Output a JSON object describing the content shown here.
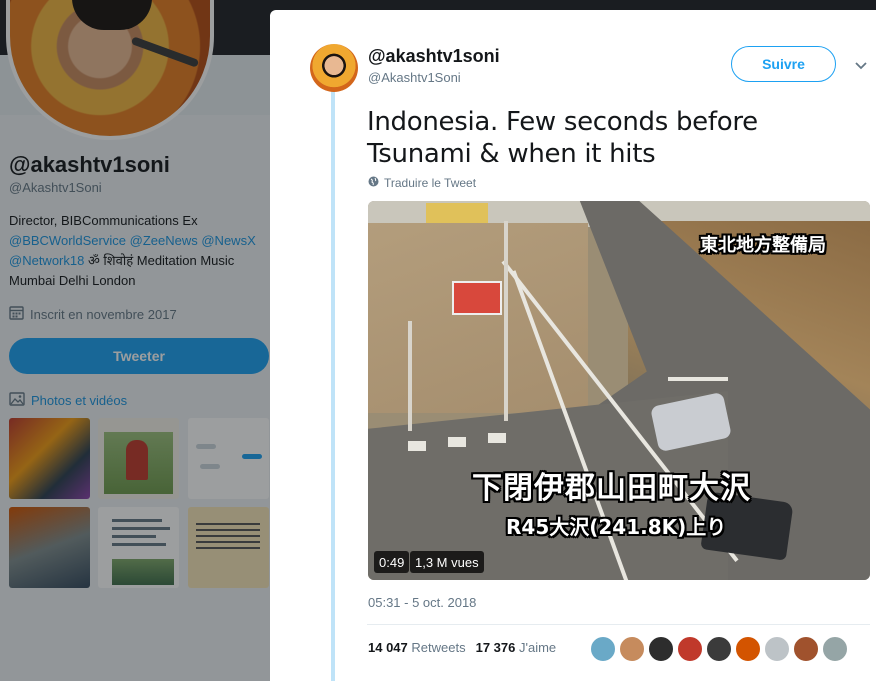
{
  "profile": {
    "name": "@akashtv1soni",
    "handle": "@Akashtv1Soni",
    "bio_text": "Director, BIBCommunications Ex",
    "bio_links": [
      "@BBCWorldService",
      "@ZeeNews",
      "@NewsX",
      "@Network18"
    ],
    "bio_tail": "ॐ शिवोहं Meditation Music Mumbai Delhi London",
    "joined": "Inscrit en novembre 2017",
    "tweet_button": "Tweeter",
    "photos_title": "Photos et vidéos",
    "thumb3_line": "Photos et vidéos"
  },
  "tweet": {
    "author_name": "@akashtv1soni",
    "author_handle": "@Akashtv1Soni",
    "follow_label": "Suivre",
    "text": "Indonesia. Few seconds before Tsunami & when it hits",
    "translate_label": "Traduire le Tweet",
    "video": {
      "overlay_top": "東北地方整備局",
      "overlay_main": "下閉伊郡山田町大沢",
      "overlay_sub": "R45大沢(241.8K)上り",
      "duration": "0:49",
      "views": "1,3 M vues"
    },
    "timestamp": "05:31 - 5 oct. 2018",
    "retweets_count": "14 047",
    "retweets_label": "Retweets",
    "likes_count": "17 376",
    "likes_label": "J'aime"
  },
  "colors": {
    "accent": "#1da1f2",
    "text": "#14171a",
    "muted": "#657786",
    "liker_avatars": [
      "#6aa9c7",
      "#c68b5d",
      "#2d2d2d",
      "#c0392b",
      "#3b3b3b",
      "#d35400",
      "#bdc3c7",
      "#a0522d",
      "#95a5a6"
    ]
  },
  "icons": {
    "calendar": "calendar-icon",
    "photo": "photo-icon",
    "globe": "globe-icon",
    "caret": "chevron-down-icon"
  }
}
